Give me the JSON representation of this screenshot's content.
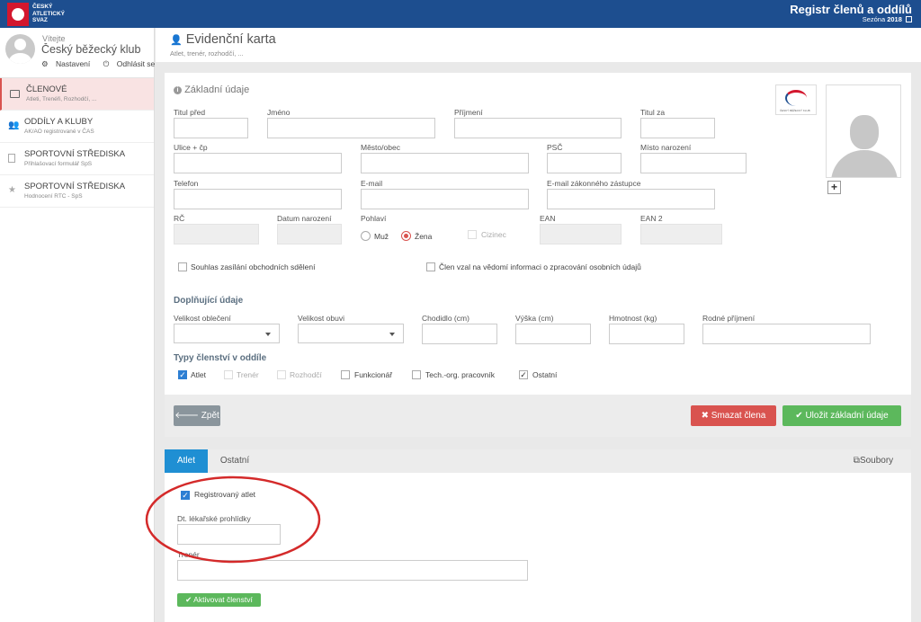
{
  "header": {
    "logo_lines": [
      "ČESKÝ",
      "ATLETICKÝ",
      "SVAZ"
    ],
    "app_title": "Registr členů a oddílů",
    "season_label": "Sezóna",
    "season_year": "2018"
  },
  "user": {
    "welcome": "Vítejte",
    "name": "Český běžecký klub",
    "settings": "Nastavení",
    "logout": "Odhlásit se"
  },
  "nav": [
    {
      "title": "ČLENOVÉ",
      "subtitle": "Atleti, Trenéři, Rozhodčí, ...",
      "icon": "card-icon"
    },
    {
      "title": "ODDÍLY A KLUBY",
      "subtitle": "AK/AO registrované v ČAS",
      "icon": "users-icon"
    },
    {
      "title": "SPORTOVNÍ STŘEDISKA",
      "subtitle": "Přihlašovací formulář SpS",
      "icon": "document-icon"
    },
    {
      "title": "SPORTOVNÍ STŘEDISKA",
      "subtitle": "Hodnocení RTC - SpS",
      "icon": "star-icon"
    }
  ],
  "page": {
    "title": "Evidenční karta",
    "subtitle": "Atlet, trenér, rozhodčí, ..."
  },
  "basic": {
    "section_title": "Základní údaje",
    "club_logo_text": "ČESKÝ BĚŽECKÝ KLUB",
    "labels": {
      "titul_pred": "Titul před",
      "jmeno": "Jméno",
      "prijmeni": "Příjmení",
      "titul_za": "Titul za",
      "ulice": "Ulice + čp",
      "mesto": "Město/obec",
      "psc": "PSČ",
      "misto_narozeni": "Místo narození",
      "telefon": "Telefon",
      "email": "E-mail",
      "email_zastupce": "E-mail zákonného zástupce",
      "rc": "RČ",
      "datum_narozeni": "Datum narození",
      "pohlavi": "Pohlaví",
      "muz": "Muž",
      "zena": "Žena",
      "cizinec": "Cizinec",
      "ean": "EAN",
      "ean2": "EAN 2",
      "souhlas": "Souhlas zasílání obchodních sdělení",
      "gdpr": "Člen vzal na vědomí informaci o zpracování osobních údajů"
    }
  },
  "extra": {
    "section_title": "Doplňující údaje",
    "labels": {
      "obleceni": "Velikost oblečení",
      "obuv": "Velikost obuvi",
      "chodidlo": "Chodidlo (cm)",
      "vyska": "Výška (cm)",
      "hmotnost": "Hmotnost (kg)",
      "rodne_prijmeni": "Rodné příjmení"
    }
  },
  "membership": {
    "section_title": "Typy členství v oddíle",
    "types": [
      {
        "label": "Atlet",
        "state": "checked"
      },
      {
        "label": "Trenér",
        "state": "disabled"
      },
      {
        "label": "Rozhodčí",
        "state": "disabled"
      },
      {
        "label": "Funkcionář",
        "state": "unchecked"
      },
      {
        "label": "Tech.-org. pracovník",
        "state": "unchecked"
      },
      {
        "label": "Ostatní",
        "state": "ticked"
      }
    ]
  },
  "actions": {
    "back": "Zpět",
    "delete": "Smazat člena",
    "save": "Uložit základní údaje"
  },
  "tabs": {
    "items": [
      "Atlet",
      "Ostatní"
    ],
    "files": "Soubory"
  },
  "athlete": {
    "registered": "Registrovaný atlet",
    "medical_date": "Dt. lékařské prohlídky",
    "coach": "Trenér",
    "activate": "Aktivovat členství"
  },
  "colors": {
    "header": "#1d4e8f",
    "accent": "#1f8fd3",
    "danger": "#d9534f",
    "success": "#5cb85c",
    "annotation": "#d42a2a"
  }
}
